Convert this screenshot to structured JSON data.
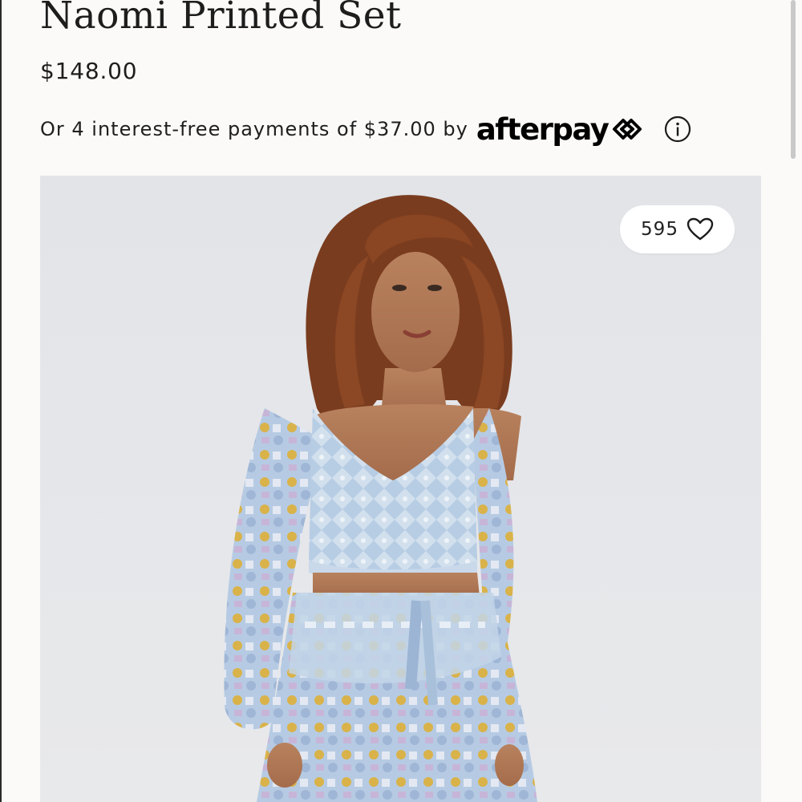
{
  "product": {
    "title": "Naomi Printed Set",
    "price": "$148.00"
  },
  "afterpay": {
    "text": "Or 4 interest-free payments of $37.00 by",
    "logo_text": "afterpay",
    "logo_icon": "afterpay-arrows-icon",
    "info_icon": "info-icon"
  },
  "image": {
    "alt": "Model wearing a blue printed crop top and tiered skirt set",
    "like_count": "595",
    "like_icon": "heart-icon"
  },
  "colors": {
    "background": "#fbfaf8",
    "photo_background": "#e3e5e9",
    "text": "#1c1c1c"
  }
}
